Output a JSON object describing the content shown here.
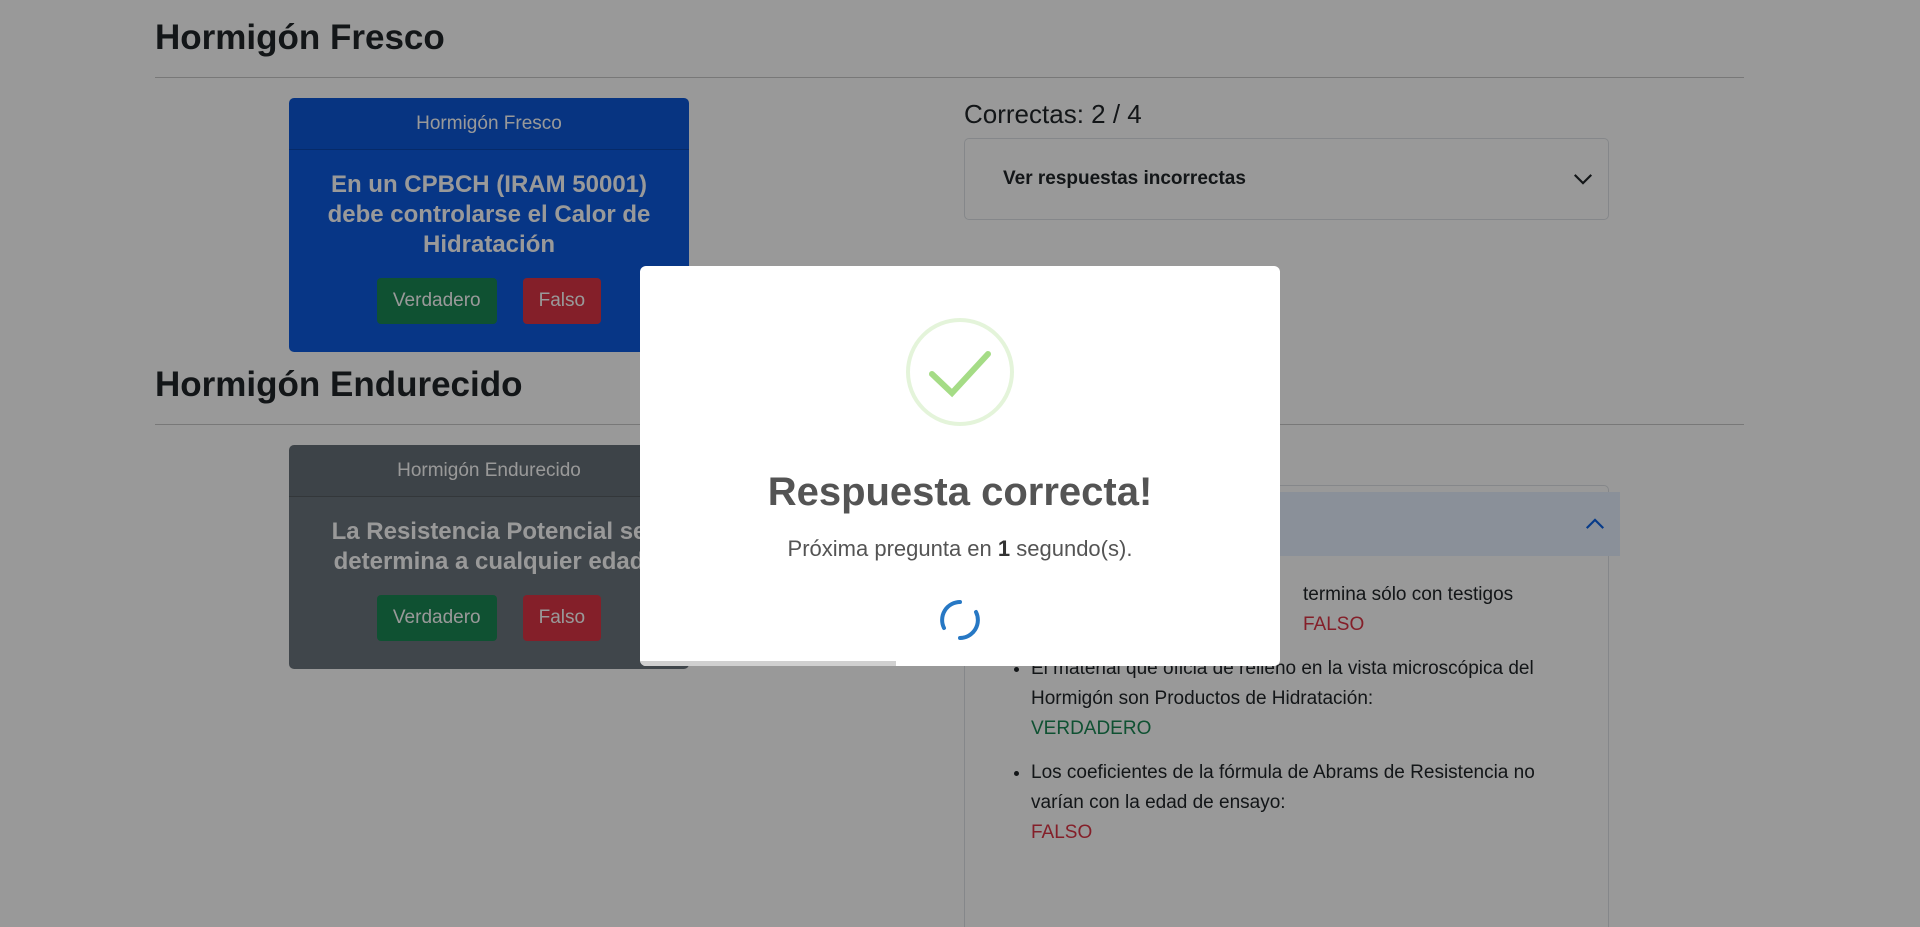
{
  "sections": {
    "fresco": {
      "title": "Hormigón Fresco",
      "card_header": "Hormigón Fresco",
      "question": "En un CPBCH (IRAM 50001) debe controlarse el Calor de Hidratación",
      "true_label": "Verdadero",
      "false_label": "Falso"
    },
    "endurecido": {
      "title": "Hormigón Endurecido",
      "card_header": "Hormigón Endurecido",
      "question": "La Resistencia Potencial se determina a cualquier edad",
      "true_label": "Verdadero",
      "false_label": "Falso"
    }
  },
  "results": {
    "score": "Correctas: 2 / 4",
    "accordion_label": "Ver respuestas incorrectas"
  },
  "incorrect_answers": [
    {
      "text": "termina sólo con testigos",
      "answer": "FALSO"
    },
    {
      "text": "El material que oficia de relleno en la vista microscópica del Hormigón son Productos de Hidratación:",
      "answer": "VERDADERO"
    },
    {
      "text": "Los coeficientes de la fórmula de Abrams de Resistencia no varían con la edad de ensayo:",
      "answer": "FALSO"
    }
  ],
  "modal": {
    "title": "Respuesta correcta!",
    "text_before": "Próxima pregunta en ",
    "seconds": "1",
    "text_after": " segundo(s).",
    "progress_fraction": 0.4
  },
  "colors": {
    "primary": "#0d5be0",
    "success": "#198754",
    "danger": "#dc3545",
    "secondary": "#6c757d",
    "success_icon": "#a5dc86"
  },
  "icons": [
    "chevron-down-icon",
    "chevron-up-icon",
    "success-check-icon",
    "loading-spinner-icon"
  ]
}
